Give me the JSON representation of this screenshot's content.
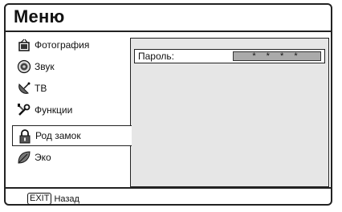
{
  "header": {
    "title": "Меню"
  },
  "sidebar": {
    "items": [
      {
        "label": "Фотография",
        "icon": "photo-icon"
      },
      {
        "label": "Звук",
        "icon": "speaker-icon"
      },
      {
        "label": "ТВ",
        "icon": "satellite-dish-icon"
      },
      {
        "label": "Функции",
        "icon": "tools-icon"
      },
      {
        "label": "Род замок",
        "icon": "padlock-icon",
        "selected": true
      },
      {
        "label": "Эко",
        "icon": "leaf-icon"
      }
    ]
  },
  "main": {
    "password_label": "Пароль:",
    "password_value": "* * * *"
  },
  "footer": {
    "exit_key": "EXIT",
    "exit_label": "Назад"
  }
}
